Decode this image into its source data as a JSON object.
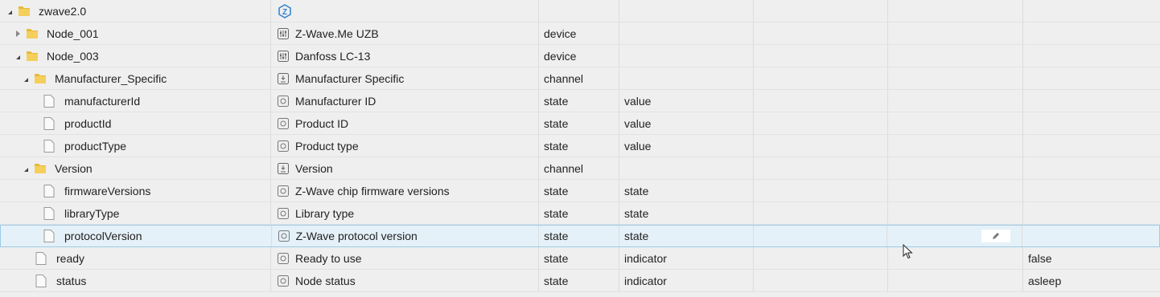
{
  "rows": [
    {
      "name": "zwave2.0",
      "title": "",
      "type": "",
      "role": "",
      "value": ""
    },
    {
      "name": "Node_001",
      "title": "Z-Wave.Me UZB",
      "type": "device",
      "role": "",
      "value": ""
    },
    {
      "name": "Node_003",
      "title": "Danfoss LC-13",
      "type": "device",
      "role": "",
      "value": ""
    },
    {
      "name": "Manufacturer_Specific",
      "title": "Manufacturer Specific",
      "type": "channel",
      "role": "",
      "value": ""
    },
    {
      "name": "manufacturerId",
      "title": "Manufacturer ID",
      "type": "state",
      "role": "value",
      "value": ""
    },
    {
      "name": "productId",
      "title": "Product ID",
      "type": "state",
      "role": "value",
      "value": ""
    },
    {
      "name": "productType",
      "title": "Product type",
      "type": "state",
      "role": "value",
      "value": ""
    },
    {
      "name": "Version",
      "title": "Version",
      "type": "channel",
      "role": "",
      "value": ""
    },
    {
      "name": "firmwareVersions",
      "title": "Z-Wave chip firmware versions",
      "type": "state",
      "role": "state",
      "value": ""
    },
    {
      "name": "libraryType",
      "title": "Library type",
      "type": "state",
      "role": "state",
      "value": ""
    },
    {
      "name": "protocolVersion",
      "title": "Z-Wave protocol version",
      "type": "state",
      "role": "state",
      "value": ""
    },
    {
      "name": "ready",
      "title": "Ready to use",
      "type": "state",
      "role": "indicator",
      "value": "false"
    },
    {
      "name": "status",
      "title": "Node status",
      "type": "state",
      "role": "indicator",
      "value": "asleep"
    }
  ],
  "icons": {
    "adapter": "zwave-adapter-icon",
    "device": "sliders-icon",
    "channel": "info-box-icon",
    "state": "state-circle-icon",
    "folder": "folder-icon",
    "file": "file-icon",
    "edit": "pencil-icon"
  },
  "colors": {
    "selected_bg": "#e5f1f8",
    "selected_border": "#9ccbe6",
    "folder": "#e8b93a",
    "adapter_icon": "#2f7fd0"
  }
}
